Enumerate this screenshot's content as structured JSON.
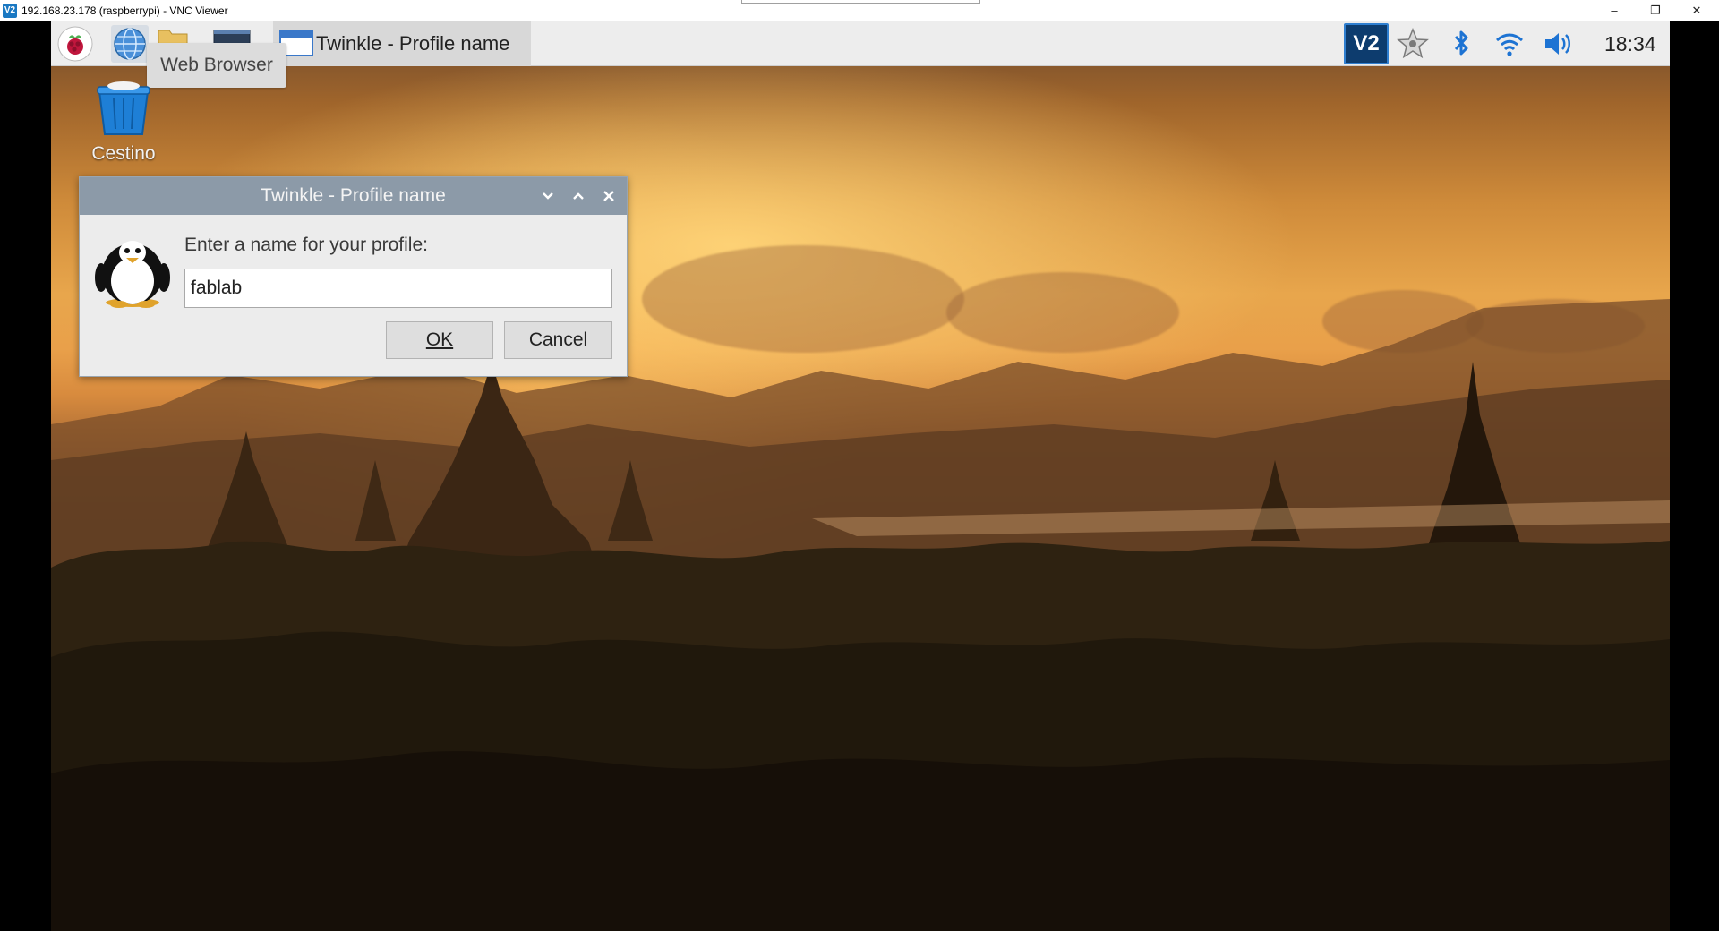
{
  "vnc_window": {
    "title": "192.168.23.178 (raspberrypi) - VNC Viewer",
    "app_icon": "V2",
    "controls": {
      "minimize": "–",
      "maximize": "❐",
      "close": "✕"
    }
  },
  "taskbar": {
    "tooltip": "Web Browser",
    "task_item": "Twinkle - Profile name",
    "vnc_tray_label": "V2",
    "clock": "18:34",
    "icons": [
      "raspberry-menu-icon",
      "globe-icon",
      "folder-icon",
      "terminal-icon",
      "window-icon",
      "vnc-icon",
      "star-icon",
      "bluetooth-icon",
      "wifi-icon",
      "volume-icon"
    ]
  },
  "desktop": {
    "trash_label": "Cestino"
  },
  "dialog": {
    "title": "Twinkle - Profile name",
    "prompt": "Enter a name for your profile:",
    "input_value": "fablab",
    "ok_label": "OK",
    "cancel_label": "Cancel"
  },
  "colors": {
    "dialog_titlebar": "#8c9aa8",
    "taskbar": "#ededed",
    "vnc_accent": "#2f7fd0"
  }
}
